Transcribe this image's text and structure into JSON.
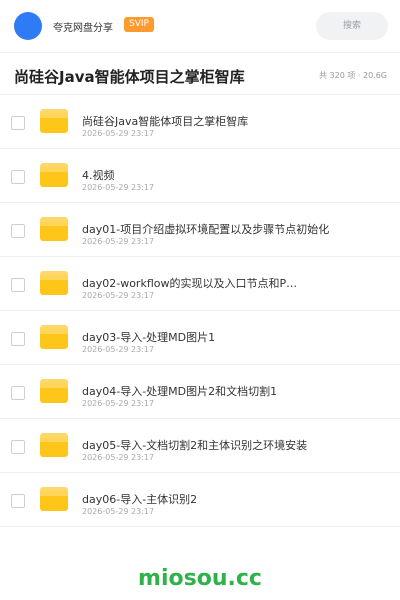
{
  "header": {
    "share_title": "夸克网盘分享",
    "badge": "SVIP",
    "search_placeholder": "搜索",
    "avatar_color": "#2f7bf6",
    "badge_color": "#ff9a2e"
  },
  "page": {
    "title": "尚硅谷Java智能体项目之掌柜智库",
    "meta": "共 320 项 · 20.6G"
  },
  "items": [
    {
      "name": "尚硅谷Java智能体项目之掌柜智库",
      "date": "2026-05-29 23:17"
    },
    {
      "name": "4.视频",
      "date": "2026-05-29 23:17"
    },
    {
      "name": "day01-项目介绍虚拟环境配置以及步骤节点初始化",
      "date": "2026-05-29 23:17"
    },
    {
      "name": "day02-workflow的实现以及入口节点和P…",
      "date": "2026-05-29 23:17"
    },
    {
      "name": "day03-导入-处理MD图片1",
      "date": "2026-05-29 23:17"
    },
    {
      "name": "day04-导入-处理MD图片2和文档切割1",
      "date": "2026-05-29 23:17"
    },
    {
      "name": "day05-导入-文档切割2和主体识别之环境安装",
      "date": "2026-05-29 23:17"
    },
    {
      "name": "day06-导入-主体识别2",
      "date": "2026-05-29 23:17"
    }
  ],
  "watermark": "miosou.cc",
  "icons": {
    "item_icon": "folder-icon",
    "search_icon": "none"
  }
}
